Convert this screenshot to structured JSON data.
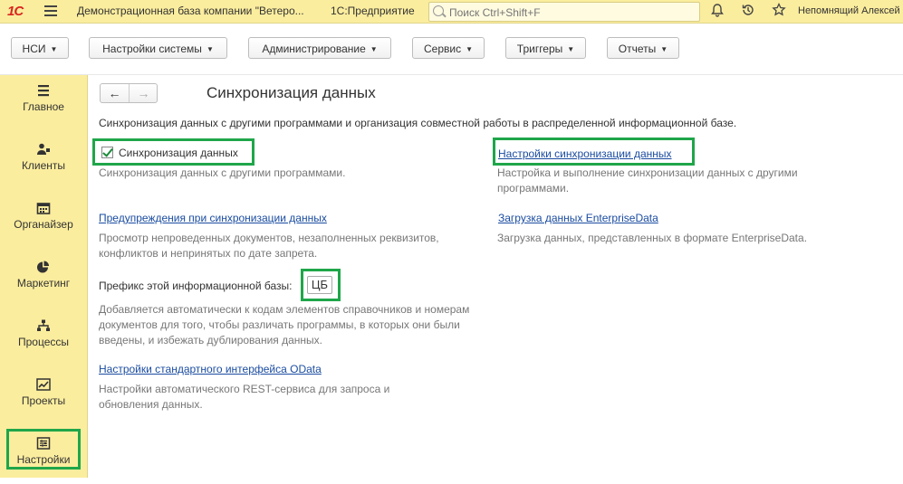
{
  "titlebar": {
    "logo": "1С",
    "app_title": "Демонстрационная база компании \"Ветеро...",
    "platform": "1С:Предприятие",
    "search_placeholder": "Поиск Ctrl+Shift+F",
    "user": "Непомнящий Алексей Е"
  },
  "menu": {
    "items": [
      {
        "label": "НСИ"
      },
      {
        "label": "Настройки системы"
      },
      {
        "label": "Администрирование"
      },
      {
        "label": "Сервис"
      },
      {
        "label": "Триггеры"
      },
      {
        "label": "Отчеты"
      }
    ]
  },
  "sidebar": {
    "items": [
      {
        "label": "Главное",
        "icon": "menu-list-icon"
      },
      {
        "label": "Клиенты",
        "icon": "users-icon"
      },
      {
        "label": "Органайзер",
        "icon": "calendar-icon"
      },
      {
        "label": "Маркетинг",
        "icon": "pie-chart-icon"
      },
      {
        "label": "Процессы",
        "icon": "hierarchy-icon"
      },
      {
        "label": "Проекты",
        "icon": "line-chart-icon"
      },
      {
        "label": "Настройки",
        "icon": "settings-sliders-icon"
      }
    ]
  },
  "page": {
    "title": "Синхронизация данных",
    "intro": "Синхронизация данных с другими программами и организация совместной работы в распределенной информационной базе.",
    "sync_checkbox_label": "Синхронизация данных",
    "sync_checkbox_desc": "Синхронизация данных с другими программами.",
    "sync_settings_link": "Настройки синхронизации данных",
    "sync_settings_desc": "Настройка и выполнение синхронизации данных с другими программами.",
    "warnings_link": "Предупреждения при синхронизации данных",
    "warnings_desc": "Просмотр непроведенных документов, незаполненных реквизитов, конфликтов и непринятых по дате запрета.",
    "enterprise_link": "Загрузка данных EnterpriseData",
    "enterprise_desc": "Загрузка данных, представленных в формате EnterpriseData.",
    "prefix_label": "Префикс этой информационной базы:",
    "prefix_value": "ЦБ",
    "prefix_desc": "Добавляется автоматически к кодам элементов справочников и номерам документов для того, чтобы различать программы, в которых они были введены, и избежать дублирования данных.",
    "odata_link": "Настройки стандартного интерфейса OData",
    "odata_desc": "Настройки автоматического REST-сервиса для запроса и обновления данных."
  }
}
